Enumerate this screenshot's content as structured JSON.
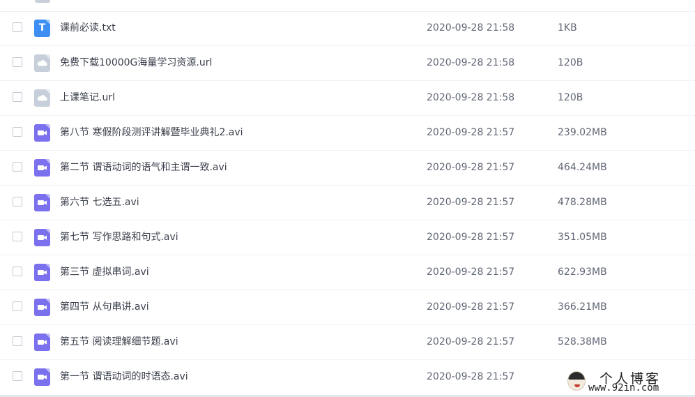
{
  "files": [
    {
      "name": "课前必读.txt",
      "date": "2020-09-28 21:58",
      "size": "1KB",
      "type": "txt",
      "icon": "text-file-icon"
    },
    {
      "name": "免费下载10000G海量学习资源.url",
      "date": "2020-09-28 21:58",
      "size": "120B",
      "type": "url",
      "icon": "cloud-file-icon"
    },
    {
      "name": "上课笔记.url",
      "date": "2020-09-28 21:58",
      "size": "120B",
      "type": "url",
      "icon": "cloud-file-icon"
    },
    {
      "name": "第八节 寒假阶段测评讲解暨毕业典礼2.avi",
      "date": "2020-09-28 21:57",
      "size": "239.02MB",
      "type": "video",
      "icon": "video-file-icon"
    },
    {
      "name": "第二节 谓语动词的语气和主谓一致.avi",
      "date": "2020-09-28 21:57",
      "size": "464.24MB",
      "type": "video",
      "icon": "video-file-icon"
    },
    {
      "name": "第六节 七选五.avi",
      "date": "2020-09-28 21:57",
      "size": "478.28MB",
      "type": "video",
      "icon": "video-file-icon"
    },
    {
      "name": "第七节 写作思路和句式.avi",
      "date": "2020-09-28 21:57",
      "size": "351.05MB",
      "type": "video",
      "icon": "video-file-icon"
    },
    {
      "name": "第三节 虚拟串词.avi",
      "date": "2020-09-28 21:57",
      "size": "622.93MB",
      "type": "video",
      "icon": "video-file-icon"
    },
    {
      "name": "第四节 从句串讲.avi",
      "date": "2020-09-28 21:57",
      "size": "366.21MB",
      "type": "video",
      "icon": "video-file-icon"
    },
    {
      "name": "第五节 阅读理解细节题.avi",
      "date": "2020-09-28 21:57",
      "size": "528.38MB",
      "type": "video",
      "icon": "video-file-icon"
    },
    {
      "name": "第一节 谓语动词的时语态.avi",
      "date": "2020-09-28 21:57",
      "size": "",
      "type": "video",
      "icon": "video-file-icon"
    }
  ],
  "icon_colors": {
    "txt": "#3e8ff3",
    "url": "#c7d0da",
    "video": "#7b70ee"
  },
  "watermark": {
    "title": "个人博客",
    "url": "www.92in.com"
  }
}
